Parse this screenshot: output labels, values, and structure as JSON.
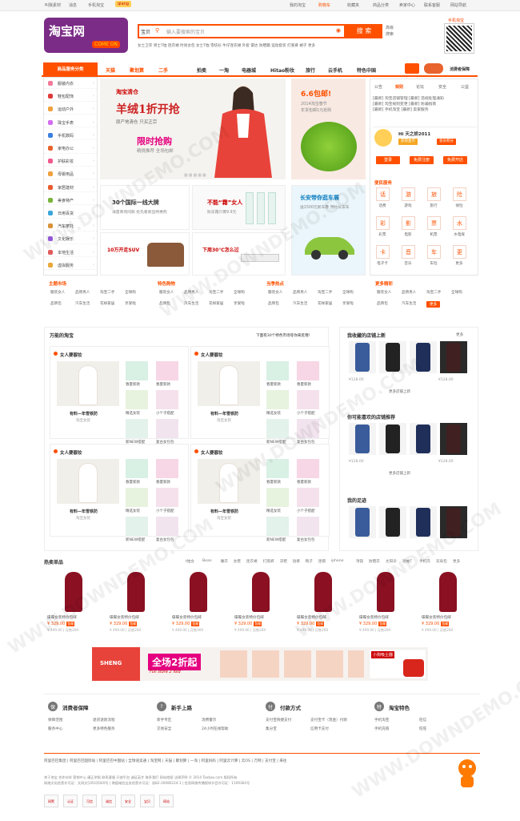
{
  "topbar": {
    "left": [
      "叫我素材",
      "消息",
      "手机淘宝"
    ],
    "badge": "qiang",
    "right": [
      "我的淘宝",
      "购物车",
      "收藏夹",
      "商品分类",
      "卖家中心",
      "联系客服",
      "网站导航"
    ]
  },
  "header": {
    "logo_cn": "淘宝网",
    "logo_en": "COME ON",
    "search_tab": "宝贝",
    "search_placeholder": "输入要搜索的宝贝",
    "search_button": "搜 索",
    "advanced": [
      "高级",
      "搜索"
    ],
    "hot_words": "女士卫衣 男士T恤 连衣裙 时尚女包 女士T恤 雪纺衫 牛仔连衣裙 外套 雷达 防晒霜 运动套装 打底裤 裙子 更多",
    "qr_label": "手机淘宝"
  },
  "nav": {
    "category_label": "商品服务分类",
    "items": [
      "天猫",
      "聚划算",
      "二手",
      "拍卖",
      "一淘",
      "电器城",
      "Hitao粉妆",
      "旅行",
      "云手机",
      "特色中国"
    ],
    "right_label": "消费者保障"
  },
  "sidebar": [
    {
      "label": "服装内衣",
      "color": "#f17a9a"
    },
    {
      "label": "鞋包配饰",
      "color": "#e03b3b"
    },
    {
      "label": "运动户外",
      "color": "#f1a13e"
    },
    {
      "label": "珠宝手表",
      "color": "#d36df0"
    },
    {
      "label": "手机数码",
      "color": "#3b7fe0"
    },
    {
      "label": "家电办公",
      "color": "#e8632d"
    },
    {
      "label": "护肤彩妆",
      "color": "#f05a8d"
    },
    {
      "label": "母婴用品",
      "color": "#f0a13e"
    },
    {
      "label": "家居建材",
      "color": "#e85b2d"
    },
    {
      "label": "美食特产",
      "color": "#7ab33a"
    },
    {
      "label": "日用百货",
      "color": "#3aa6d9"
    },
    {
      "label": "汽车摩托",
      "color": "#d9923a"
    },
    {
      "label": "文化娱乐",
      "color": "#9a5be0"
    },
    {
      "label": "本地生活",
      "color": "#e05b5b"
    },
    {
      "label": "虚拟服务",
      "color": "#e8a83a"
    }
  ],
  "banner": {
    "brand": "淘宝清仓",
    "headline": "羊绒1折开抢",
    "sub": "原产地清仓 只买正宗",
    "flash": "限时抢购",
    "flash_sub": "精挑推荐 全场包邮"
  },
  "promo66": {
    "title": "6.6包邮!",
    "lines": [
      "2014淘宝春节",
      "年货包邮1元抢购"
    ]
  },
  "subbanners": [
    {
      "title": "30个国际一线大牌",
      "sub": "海量商场同款 抢先看新品特惠购"
    },
    {
      "title": "不能“霜”女人",
      "sub": "防冻霜只要9.9元"
    },
    {
      "title": "长安带你逛车展",
      "sub": "送1500元新车券 预约长安车"
    },
    {
      "title": "10万开走SUV",
      "sub": ""
    },
    {
      "title": "下周30℃怎么过",
      "sub": ""
    }
  ],
  "right": {
    "tabs": [
      "公告",
      "规则",
      "论坛",
      "安全",
      "公益"
    ],
    "news": [
      "[最新] 淘宝店铺管理 [最新] 违规处理通知",
      "[最新] 淘宝规则变更 [最新] 防骗指南",
      "[最新] 手机淘宝 [最新] 卖家服务"
    ],
    "user_name": "Hi 天之娇2011",
    "badge1": "获得金币",
    "badge2": "会员积分",
    "btn_login": "登录",
    "btn_register": "免费注册",
    "btn_shop": "免费开店",
    "service_title": "便民服务",
    "services": [
      {
        "icon": "话",
        "label": "话费"
      },
      {
        "icon": "游",
        "label": "游戏"
      },
      {
        "icon": "旅",
        "label": "旅行"
      },
      {
        "icon": "险",
        "label": "保险"
      },
      {
        "icon": "彩",
        "label": "彩票"
      },
      {
        "icon": "影",
        "label": "电影"
      },
      {
        "icon": "票",
        "label": "机票"
      },
      {
        "icon": "水",
        "label": "水电煤"
      },
      {
        "icon": "卡",
        "label": "电子卡"
      },
      {
        "icon": "音",
        "label": "音乐"
      },
      {
        "icon": "车",
        "label": "车险"
      },
      {
        "icon": "更",
        "label": "更多"
      }
    ]
  },
  "categories4": [
    {
      "title": "主题市场",
      "links": [
        "服装女人",
        "品牌男人",
        "淘宝二手",
        "全球购",
        "品牌包",
        "汽车生活",
        "花样家居",
        "享受啦"
      ]
    },
    {
      "title": "特色购物",
      "links": [
        "服装女人",
        "品牌男人",
        "淘宝二手",
        "全球购",
        "品牌包",
        "汽车生活",
        "花样家居",
        "享受啦"
      ]
    },
    {
      "title": "当季热点",
      "links": [
        "服装女人",
        "品牌男人",
        "淘宝二手",
        "全球购",
        "品牌包",
        "汽车生活",
        "花样家居",
        "享受啦"
      ]
    },
    {
      "title": "更多精彩",
      "links": [
        "服装女人",
        "品牌男人",
        "淘宝二手",
        "全球购",
        "品牌包",
        "汽车生活",
        "更多"
      ]
    }
  ],
  "feed": {
    "title": "万能的淘宝",
    "note": "下面有30个特色市场等你来逛哦!",
    "card_head": "女人要靓妆",
    "card_title": "有料—年雪铁防",
    "card_sub": "淘宝女装",
    "thumbs": [
      "春夏新款",
      "春夏新款",
      "精选女装",
      "小个子搭配",
      "新NEW搭配",
      "复古女包包"
    ]
  },
  "stores": {
    "title1": "我收藏的店铺上新",
    "more": "更多",
    "title2": "你可能喜欢的店铺推荐",
    "title3": "我的足迹",
    "price": "¥128.00",
    "link": "更多店铺上新"
  },
  "hot": {
    "title": "热卖单品",
    "filters": [
      "t恤女",
      "Bean",
      "睡衣",
      "女鞋",
      "连衣裙",
      "打底裤",
      "凉鞋",
      "短裤",
      "靴子",
      "连帽",
      "iphone",
      "项链",
      "防晒衣",
      "太阳伞",
      "短袖T",
      "手机壳",
      "双肩包",
      "更多"
    ],
    "products": [
      {
        "name": "碟蝶女装特价包邮",
        "price": "¥ 329.00",
        "tag": "包邮",
        "old": "¥ 499.00 | 月售269"
      },
      {
        "name": "碟蝶女装特价包邮",
        "price": "¥ 329.00",
        "tag": "包邮",
        "old": "¥ 499.00 | 月售269"
      },
      {
        "name": "碟蝶女装特价包邮",
        "price": "¥ 329.00",
        "tag": "包邮",
        "old": "¥ 499.00 | 月售269"
      },
      {
        "name": "碟蝶女装特价包邮",
        "price": "¥ 329.00",
        "tag": "包邮",
        "old": "¥ 499.00 | 月售269"
      },
      {
        "name": "碟蝶女装特价包邮",
        "price": "¥ 329.00",
        "tag": "包邮",
        "old": "¥ 499.00 | 月售269"
      },
      {
        "name": "碟蝶女装特价包邮",
        "price": "¥ 329.00",
        "tag": "包邮",
        "old": "¥ 499.00 | 月售269"
      },
      {
        "name": "碟蝶女装特价包邮",
        "price": "¥ 329.00",
        "tag": "包邮",
        "old": "¥ 499.00 | 月售269"
      }
    ]
  },
  "ad": {
    "brand": "小狗吸尘器",
    "headline": "全场2折起",
    "sub": "Full store 2 fold",
    "label": "SHENG"
  },
  "guides": [
    {
      "icon": "保",
      "title": "消费者保障",
      "links": [
        "保障范围",
        "退货退款流程",
        "服务中心",
        "更多特色服务"
      ]
    },
    {
      "icon": "?",
      "title": "新手上路",
      "links": [
        "新手专区",
        "消费警示",
        "交易安全",
        "24小时在线帮助"
      ]
    },
    {
      "icon": "付",
      "title": "付款方式",
      "links": [
        "支付宝快捷支付",
        "支付宝卡（现金）付款",
        "集分宝",
        "信用卡支付"
      ]
    },
    {
      "icon": "特",
      "title": "淘宝特色",
      "links": [
        "手机淘宝",
        "旺信",
        "手机充值",
        "旺旺"
      ]
    }
  ],
  "footer": {
    "links": "阿里巴巴集团 | 阿里巴巴国际站 | 阿里巴巴中国站 | 全球速卖通 | 淘宝网 | 天猫 | 聚划算 | 一淘 | 阿里妈妈 | 阿里云计算 | 云OS | 万网 | 支付宝 | 来往",
    "lines": [
      "关于淘宝 合作伙伴 营销中心 廉正举报 联系客服 开放平台 诚征英才 联系我们 网站地图 法律声明 © 2014 Taobao.com 版权所有",
      "网络文化经营许可证：文网文[2010]040号 | 增值电信业务经营许可证：浙B2-20080224-1 | 信息网络传播视听节目许可证：1109364号"
    ],
    "badges": [
      "网警",
      "认证",
      "可信",
      "诚信",
      "安全",
      "宝贝",
      "网站"
    ]
  },
  "watermark": "WWW.DOWNDEMO.COM"
}
